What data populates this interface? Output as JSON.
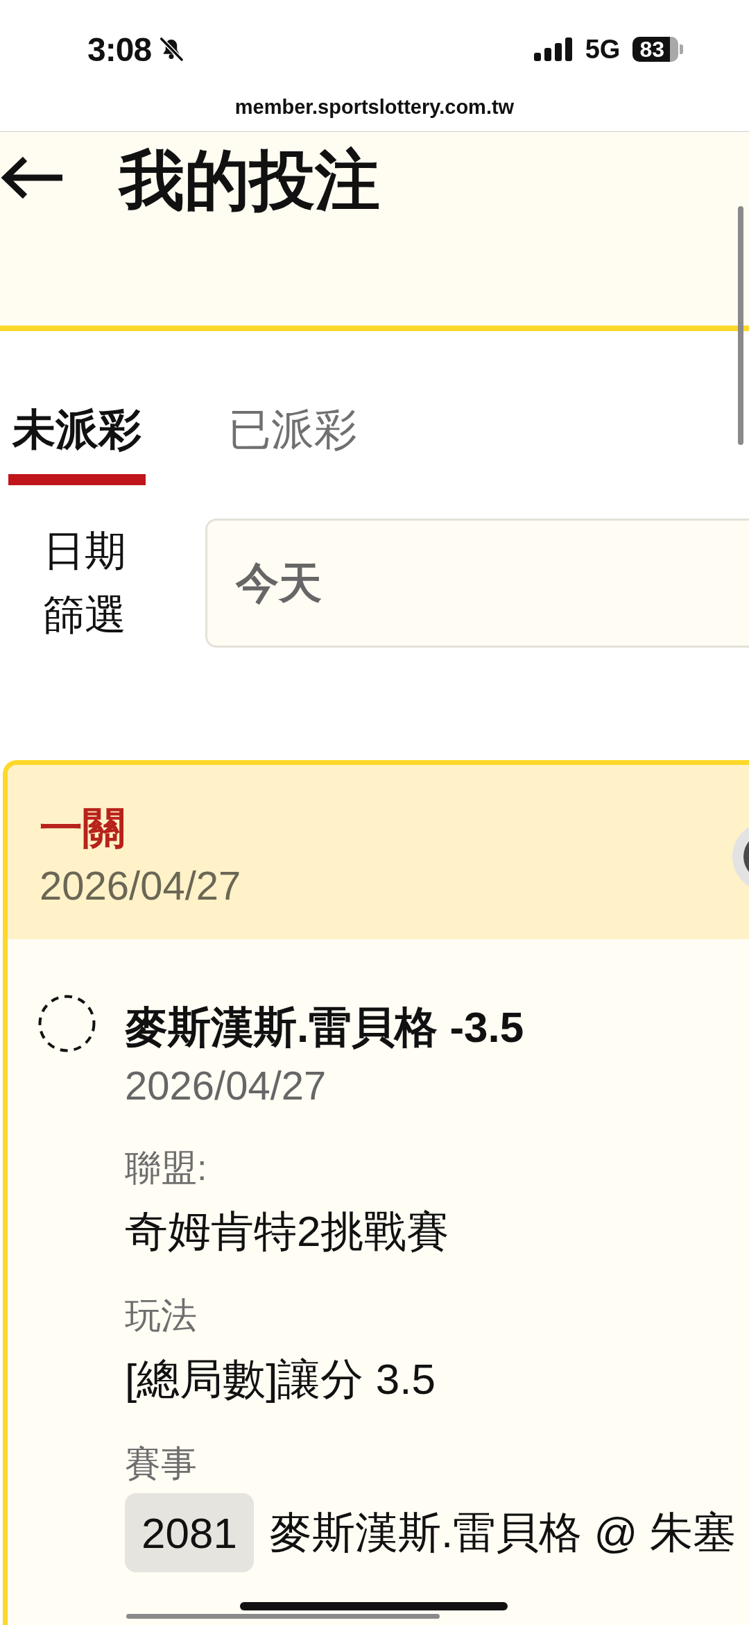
{
  "status_bar": {
    "time": "3:08",
    "network": "5G",
    "battery": "83"
  },
  "browser": {
    "url": "member.sportslottery.com.tw"
  },
  "header": {
    "title": "我的投注"
  },
  "tabs": [
    {
      "label": "未派彩",
      "selected": true
    },
    {
      "label": "已派彩",
      "selected": false
    }
  ],
  "date_filter": {
    "label": "日期篩選",
    "value": "今天"
  },
  "bets": [
    {
      "type": "一關",
      "date": "2026/04/27",
      "selections": [
        {
          "title": "麥斯漢斯.雷貝格 -3.5",
          "date": "2026/04/27",
          "fields": [
            {
              "kind": "text",
              "label": "聯盟:",
              "value": "奇姆肯特2挑戰賽"
            },
            {
              "kind": "text",
              "label": "玩法",
              "value": "[總局數]讓分 3.5"
            },
            {
              "kind": "event",
              "label": "賽事",
              "code": "2081",
              "value": "麥斯漢斯.雷貝格 @ 朱塞"
            }
          ]
        }
      ]
    }
  ]
}
